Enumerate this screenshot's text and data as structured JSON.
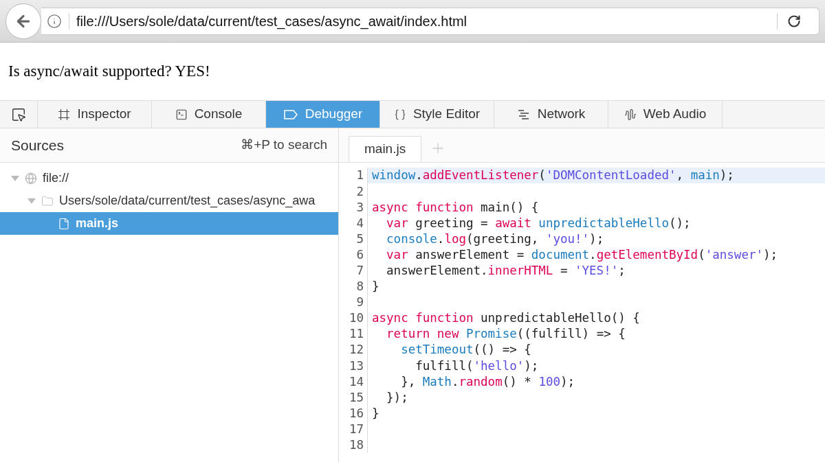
{
  "browser": {
    "url": "file:///Users/sole/data/current/test_cases/async_await/index.html"
  },
  "page": {
    "text": "Is async/await supported? YES!"
  },
  "devtools_tabs": [
    {
      "label": "Inspector",
      "kind": "inspector",
      "selected": false
    },
    {
      "label": "Console",
      "kind": "console",
      "selected": false
    },
    {
      "label": "Debugger",
      "kind": "debugger",
      "selected": true
    },
    {
      "label": "Style Editor",
      "kind": "style",
      "selected": false
    },
    {
      "label": "Network",
      "kind": "network",
      "selected": false
    },
    {
      "label": "Web Audio",
      "kind": "audio",
      "selected": false
    }
  ],
  "sources": {
    "title": "Sources",
    "shortcut": "⌘+P to search",
    "tree": [
      {
        "label": "file://",
        "kind": "domain",
        "expanded": true,
        "selected": false,
        "children": [
          {
            "label": "Users/sole/data/current/test_cases/async_awa",
            "kind": "folder",
            "expanded": true,
            "selected": false,
            "children": [
              {
                "label": "main.js",
                "kind": "file",
                "selected": true
              }
            ]
          }
        ]
      }
    ]
  },
  "editor": {
    "tabs": [
      {
        "label": "main.js",
        "selected": true
      }
    ],
    "lines": [
      {
        "number": "1",
        "highlighted": true,
        "tokens": [
          {
            "kind": "call",
            "text": "window"
          },
          {
            "kind": "plain",
            "text": "."
          },
          {
            "kind": "member",
            "text": "addEventListener"
          },
          {
            "kind": "plain",
            "text": "("
          },
          {
            "kind": "str",
            "text": "'DOMContentLoaded'"
          },
          {
            "kind": "plain",
            "text": ", "
          },
          {
            "kind": "call",
            "text": "main"
          },
          {
            "kind": "plain",
            "text": ");"
          }
        ]
      },
      {
        "number": "2",
        "highlighted": false
      },
      {
        "number": "3",
        "highlighted": false,
        "tokens": [
          {
            "kind": "kw",
            "text": "async function"
          },
          {
            "kind": "plain",
            "text": " main() {"
          }
        ]
      },
      {
        "number": "4",
        "highlighted": false,
        "tokens": [
          {
            "kind": "kw",
            "text": "  var"
          },
          {
            "kind": "plain",
            "text": " greeting = "
          },
          {
            "kind": "kw",
            "text": "await"
          },
          {
            "kind": "call",
            "text": " unpredictableHello"
          },
          {
            "kind": "plain",
            "text": "();"
          }
        ]
      },
      {
        "number": "5",
        "highlighted": false,
        "tokens": [
          {
            "kind": "call",
            "text": "  console"
          },
          {
            "kind": "plain",
            "text": "."
          },
          {
            "kind": "member",
            "text": "log"
          },
          {
            "kind": "plain",
            "text": "(greeting, "
          },
          {
            "kind": "str",
            "text": "'you!'"
          },
          {
            "kind": "plain",
            "text": ");"
          }
        ]
      },
      {
        "number": "6",
        "highlighted": false,
        "tokens": [
          {
            "kind": "kw",
            "text": "  var"
          },
          {
            "kind": "plain",
            "text": " answerElement = "
          },
          {
            "kind": "call",
            "text": "document"
          },
          {
            "kind": "plain",
            "text": "."
          },
          {
            "kind": "member",
            "text": "getElementById"
          },
          {
            "kind": "plain",
            "text": "("
          },
          {
            "kind": "str",
            "text": "'answer'"
          },
          {
            "kind": "plain",
            "text": ");"
          }
        ]
      },
      {
        "number": "7",
        "highlighted": false,
        "tokens": [
          {
            "kind": "plain",
            "text": "  answerElement."
          },
          {
            "kind": "member",
            "text": "innerHTML"
          },
          {
            "kind": "plain",
            "text": " = "
          },
          {
            "kind": "str",
            "text": "'YES!'"
          },
          {
            "kind": "plain",
            "text": ";"
          }
        ]
      },
      {
        "number": "8",
        "highlighted": false,
        "tokens": [
          {
            "kind": "plain",
            "text": "}"
          }
        ]
      },
      {
        "number": "9",
        "highlighted": false
      },
      {
        "number": "10",
        "highlighted": false,
        "tokens": [
          {
            "kind": "kw",
            "text": "async function"
          },
          {
            "kind": "plain",
            "text": " unpredictableHello() {"
          }
        ]
      },
      {
        "number": "11",
        "highlighted": false,
        "tokens": [
          {
            "kind": "kw",
            "text": "  return new"
          },
          {
            "kind": "call",
            "text": " Promise"
          },
          {
            "kind": "plain",
            "text": "((fulfill) => {"
          }
        ]
      },
      {
        "number": "12",
        "highlighted": false,
        "tokens": [
          {
            "kind": "call",
            "text": "    setTimeout"
          },
          {
            "kind": "plain",
            "text": "(() => {"
          }
        ]
      },
      {
        "number": "13",
        "highlighted": false,
        "tokens": [
          {
            "kind": "plain",
            "text": "      fulfill("
          },
          {
            "kind": "str",
            "text": "'hello'"
          },
          {
            "kind": "plain",
            "text": ");"
          }
        ]
      },
      {
        "number": "14",
        "highlighted": false,
        "tokens": [
          {
            "kind": "plain",
            "text": "    }, "
          },
          {
            "kind": "call",
            "text": "Math"
          },
          {
            "kind": "plain",
            "text": "."
          },
          {
            "kind": "member",
            "text": "random"
          },
          {
            "kind": "plain",
            "text": "() * "
          },
          {
            "kind": "num",
            "text": "100"
          },
          {
            "kind": "plain",
            "text": ");"
          }
        ]
      },
      {
        "number": "15",
        "highlighted": false,
        "tokens": [
          {
            "kind": "plain",
            "text": "  });"
          }
        ]
      },
      {
        "number": "16",
        "highlighted": false,
        "tokens": [
          {
            "kind": "plain",
            "text": "}"
          }
        ]
      },
      {
        "number": "17",
        "highlighted": false
      },
      {
        "number": "18",
        "highlighted": false
      }
    ]
  }
}
